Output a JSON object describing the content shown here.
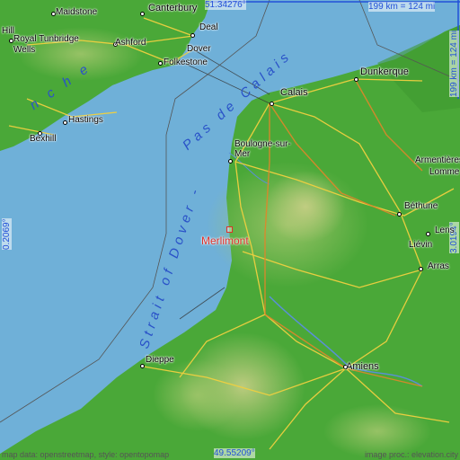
{
  "map": {
    "colors": {
      "sea": "#6fb0d8",
      "land_low": "#4aa838",
      "land_high": "#c8cf86",
      "road": "#f0d040",
      "road_major": "#e0862a",
      "coord_text": "#2250d8",
      "marker": "#e0302a"
    },
    "coordinates": {
      "top": "51.34276°",
      "bottom": "49.55209°",
      "left": "0.2069°",
      "right": "3.0194°"
    },
    "scales": {
      "horizontal": "199 km = 124 mi",
      "vertical": "199 km = 124 mi"
    },
    "marker": {
      "name": "Merlimont",
      "icon": "square-marker-icon"
    },
    "sea_labels": {
      "manche": "n c h e",
      "pas_de_calais": "Pas  de  Calais",
      "strait": "Strait  of  Dover  -"
    },
    "places": {
      "maidstone": "Maidstone",
      "canterbury": "Canterbury",
      "hill": "Hill",
      "royal_tunbridge": "Royal Tunbridge",
      "wells": "Wells",
      "ashford": "Ashford",
      "deal": "Deal",
      "dover": "Dover",
      "folkestone": "Folkestone",
      "hastings": "Hastings",
      "bexhill": "Bexhill",
      "calais": "Calais",
      "dunkerque": "Dunkerque",
      "boulogne": "Boulogne-sur-",
      "boulogne2": "Mer",
      "armentieres": "Armentières",
      "lomme": "Lomme",
      "bethune": "Béthune",
      "lens": "Lens",
      "lievin": "Liévin",
      "arras": "Arras",
      "amiens": "Amiens",
      "dieppe": "Dieppe"
    },
    "attribution": {
      "left": "map data: openstreetmap, style: opentopomap",
      "right": "image proc.: elevation.city"
    }
  }
}
